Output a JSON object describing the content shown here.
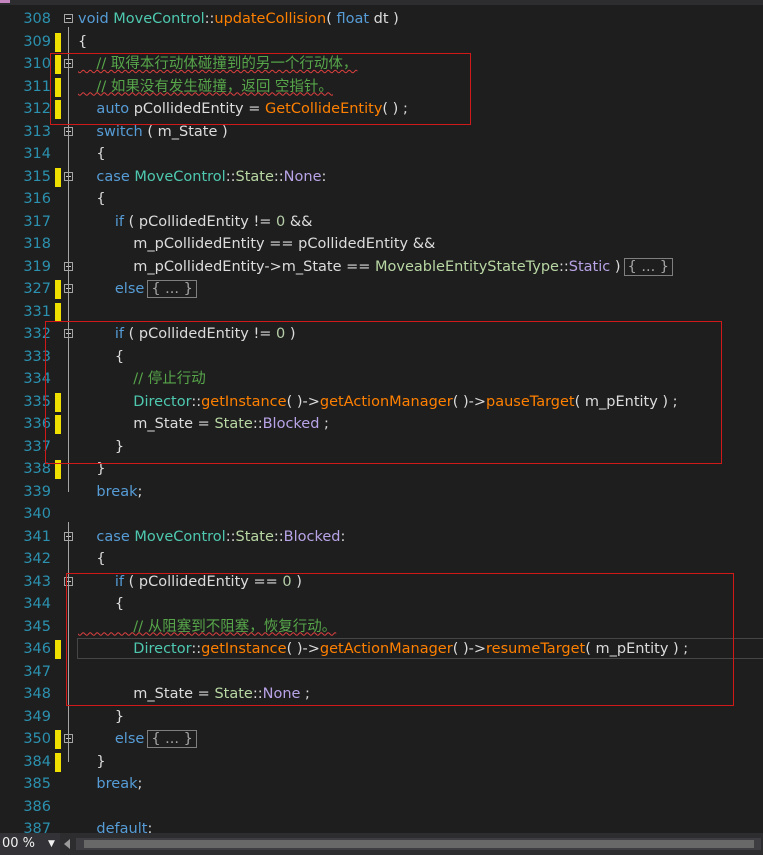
{
  "editor": {
    "zoom": "00 %"
  },
  "lines": [
    {
      "num": "308",
      "fold": "minus",
      "tokens": [
        {
          "c": "k",
          "t": "void "
        },
        {
          "c": "t",
          "t": "MoveControl"
        },
        {
          "c": "v",
          "t": "::"
        },
        {
          "c": "f",
          "t": "updateCollision"
        },
        {
          "c": "v",
          "t": "( "
        },
        {
          "c": "k",
          "t": "float"
        },
        {
          "c": "v",
          "t": " dt )"
        }
      ]
    },
    {
      "num": "309",
      "chg": true,
      "tokens": [
        {
          "c": "v",
          "t": "{"
        }
      ]
    },
    {
      "num": "310",
      "chg": true,
      "fold": "minus",
      "tokens": [
        {
          "c": "c",
          "t": "    // 取得本行动体碰撞到的另一个行动体，",
          "sq": true
        }
      ]
    },
    {
      "num": "311",
      "chg": true,
      "tokens": [
        {
          "c": "c",
          "t": "    // 如果没有发生碰撞，返回 空指针。",
          "sq": true
        }
      ]
    },
    {
      "num": "312",
      "chg": true,
      "tokens": [
        {
          "c": "k",
          "t": "    auto "
        },
        {
          "c": "v",
          "t": "pCollidedEntity = "
        },
        {
          "c": "f",
          "t": "GetCollideEntity"
        },
        {
          "c": "v",
          "t": "( ) ;"
        }
      ]
    },
    {
      "num": "313",
      "fold": "minus",
      "tokens": [
        {
          "c": "k",
          "t": "    switch"
        },
        {
          "c": "v",
          "t": " ( m_State )"
        }
      ]
    },
    {
      "num": "314",
      "tokens": [
        {
          "c": "v",
          "t": "    {"
        }
      ]
    },
    {
      "num": "315",
      "chg": true,
      "fold": "minus",
      "tokens": [
        {
          "c": "k",
          "t": "    case "
        },
        {
          "c": "t",
          "t": "MoveControl"
        },
        {
          "c": "v",
          "t": "::"
        },
        {
          "c": "e",
          "t": "State"
        },
        {
          "c": "v",
          "t": "::"
        },
        {
          "c": "ec",
          "t": "None"
        },
        {
          "c": "v",
          "t": ":"
        }
      ]
    },
    {
      "num": "316",
      "tokens": [
        {
          "c": "v",
          "t": "    {"
        }
      ]
    },
    {
      "num": "317",
      "tokens": [
        {
          "c": "k",
          "t": "        if"
        },
        {
          "c": "v",
          "t": " ( pCollidedEntity != "
        },
        {
          "c": "n",
          "t": "0"
        },
        {
          "c": "v",
          "t": " &&"
        }
      ]
    },
    {
      "num": "318",
      "tokens": [
        {
          "c": "v",
          "t": "            m_pCollidedEntity == pCollidedEntity &&"
        }
      ]
    },
    {
      "num": "319",
      "fold": "plus",
      "tokens": [
        {
          "c": "v",
          "t": "            m_pCollidedEntity->m_State == "
        },
        {
          "c": "e",
          "t": "MoveableEntityStateType"
        },
        {
          "c": "v",
          "t": "::"
        },
        {
          "c": "ec",
          "t": "Static"
        },
        {
          "c": "v",
          "t": " )"
        },
        {
          "c": "box",
          "t": "{ ... }"
        }
      ]
    },
    {
      "num": "327",
      "chg": true,
      "fold": "plus",
      "tokens": [
        {
          "c": "k",
          "t": "        else"
        },
        {
          "c": "box",
          "t": "{ ... }"
        }
      ]
    },
    {
      "num": "331",
      "chg": true,
      "tokens": []
    },
    {
      "num": "332",
      "fold": "minus",
      "tokens": [
        {
          "c": "k",
          "t": "        if"
        },
        {
          "c": "v",
          "t": " ( pCollidedEntity != "
        },
        {
          "c": "n",
          "t": "0"
        },
        {
          "c": "v",
          "t": " )"
        }
      ]
    },
    {
      "num": "333",
      "tokens": [
        {
          "c": "v",
          "t": "        {"
        }
      ]
    },
    {
      "num": "334",
      "tokens": [
        {
          "c": "c",
          "t": "            // 停止行动"
        }
      ]
    },
    {
      "num": "335",
      "chg": true,
      "tokens": [
        {
          "c": "t",
          "t": "            Director"
        },
        {
          "c": "v",
          "t": "::"
        },
        {
          "c": "f",
          "t": "getInstance"
        },
        {
          "c": "v",
          "t": "( )->"
        },
        {
          "c": "f",
          "t": "getActionManager"
        },
        {
          "c": "v",
          "t": "( )->"
        },
        {
          "c": "f",
          "t": "pauseTarget"
        },
        {
          "c": "v",
          "t": "( m_pEntity ) ;"
        }
      ]
    },
    {
      "num": "336",
      "chg": true,
      "tokens": [
        {
          "c": "v",
          "t": "            m_State = "
        },
        {
          "c": "e",
          "t": "State"
        },
        {
          "c": "v",
          "t": "::"
        },
        {
          "c": "ec",
          "t": "Blocked"
        },
        {
          "c": "v",
          "t": " ;"
        }
      ]
    },
    {
      "num": "337",
      "tokens": [
        {
          "c": "v",
          "t": "        }"
        }
      ]
    },
    {
      "num": "338",
      "chg": true,
      "tokens": [
        {
          "c": "v",
          "t": "    }"
        }
      ]
    },
    {
      "num": "339",
      "tokens": [
        {
          "c": "k",
          "t": "    break"
        },
        {
          "c": "v",
          "t": ";"
        }
      ]
    },
    {
      "num": "340",
      "tokens": []
    },
    {
      "num": "341",
      "fold": "minus",
      "tokens": [
        {
          "c": "k",
          "t": "    case "
        },
        {
          "c": "t",
          "t": "MoveControl"
        },
        {
          "c": "v",
          "t": "::"
        },
        {
          "c": "e",
          "t": "State"
        },
        {
          "c": "v",
          "t": "::"
        },
        {
          "c": "ec",
          "t": "Blocked"
        },
        {
          "c": "v",
          "t": ":"
        }
      ]
    },
    {
      "num": "342",
      "tokens": [
        {
          "c": "v",
          "t": "    {"
        }
      ]
    },
    {
      "num": "343",
      "fold": "minus",
      "tokens": [
        {
          "c": "k",
          "t": "        if"
        },
        {
          "c": "v",
          "t": " ( pCollidedEntity == "
        },
        {
          "c": "n",
          "t": "0"
        },
        {
          "c": "v",
          "t": " )"
        }
      ]
    },
    {
      "num": "344",
      "tokens": [
        {
          "c": "v",
          "t": "        {"
        }
      ]
    },
    {
      "num": "345",
      "tokens": [
        {
          "c": "c",
          "t": "            // 从阻塞到不阻塞，恢复行动。",
          "sq": true
        }
      ]
    },
    {
      "num": "346",
      "chg": true,
      "current": true,
      "tokens": [
        {
          "c": "t",
          "t": "            Director"
        },
        {
          "c": "v",
          "t": "::"
        },
        {
          "c": "f",
          "t": "getInstance"
        },
        {
          "c": "v",
          "t": "( )->"
        },
        {
          "c": "f",
          "t": "getActionManager"
        },
        {
          "c": "v",
          "t": "( )->"
        },
        {
          "c": "f",
          "t": "resumeTarget"
        },
        {
          "c": "v",
          "t": "( m_pEntity ) ;"
        }
      ]
    },
    {
      "num": "347",
      "tokens": []
    },
    {
      "num": "348",
      "tokens": [
        {
          "c": "v",
          "t": "            m_State = "
        },
        {
          "c": "e",
          "t": "State"
        },
        {
          "c": "v",
          "t": "::"
        },
        {
          "c": "ec",
          "t": "None"
        },
        {
          "c": "v",
          "t": " ;"
        }
      ]
    },
    {
      "num": "349",
      "tokens": [
        {
          "c": "v",
          "t": "        }"
        }
      ]
    },
    {
      "num": "350",
      "chg": true,
      "fold": "plus",
      "tokens": [
        {
          "c": "k",
          "t": "        else"
        },
        {
          "c": "box",
          "t": "{ ... }"
        }
      ]
    },
    {
      "num": "384",
      "chg": true,
      "tokens": [
        {
          "c": "v",
          "t": "    }"
        }
      ]
    },
    {
      "num": "385",
      "tokens": [
        {
          "c": "k",
          "t": "    break"
        },
        {
          "c": "v",
          "t": ";"
        }
      ]
    },
    {
      "num": "386",
      "tokens": []
    },
    {
      "num": "387",
      "tokens": [
        {
          "c": "k",
          "t": "    default"
        },
        {
          "c": "v",
          "t": ":"
        }
      ]
    }
  ]
}
